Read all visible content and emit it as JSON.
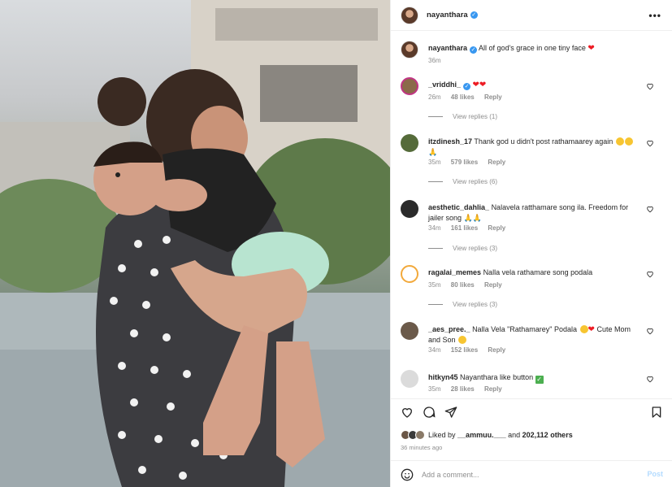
{
  "header": {
    "username": "nayanthara",
    "more": "•••"
  },
  "caption": {
    "username": "nayanthara",
    "text": "All of god's grace in one tiny face",
    "time": "36m"
  },
  "comments": [
    {
      "username": "_vriddhi_",
      "text": "",
      "time": "26m",
      "likes": "48 likes",
      "reply": "Reply",
      "view_replies": "View replies (1)"
    },
    {
      "username": "itzdinesh_17",
      "text": "Thank god u didn't post rathamaarey again",
      "time": "35m",
      "likes": "579 likes",
      "reply": "Reply",
      "view_replies": "View replies (6)"
    },
    {
      "username": "aesthetic_dahlia_",
      "text": "Nalavela ratthamare song ila. Freedom for jailer song",
      "time": "34m",
      "likes": "161 likes",
      "reply": "Reply",
      "view_replies": "View replies (3)"
    },
    {
      "username": "ragalai_memes",
      "text": "Nalla vela rathamare song podala",
      "time": "35m",
      "likes": "80 likes",
      "reply": "Reply",
      "view_replies": "View replies (3)"
    },
    {
      "username": "_aes_pree._",
      "text": "Nalla Vela \"Rathamarey\" Podala",
      "text2": "Cute Mom and Son",
      "time": "34m",
      "likes": "152 likes",
      "reply": "Reply"
    },
    {
      "username": "hitkyn45",
      "text": "Nayanthara like button",
      "time": "35m",
      "likes": "28 likes",
      "reply": "Reply"
    }
  ],
  "likes_bar": {
    "prefix": "Liked by",
    "user": "__ammuu.___",
    "and": "and",
    "count": "202,112 others"
  },
  "posted_ago": "36 minutes ago",
  "add_comment": {
    "placeholder": "Add a comment...",
    "post": "Post"
  },
  "icons": [
    "heart-icon",
    "comment-icon",
    "share-icon",
    "bookmark-icon",
    "emoji-icon",
    "more-icon",
    "verified-badge"
  ]
}
